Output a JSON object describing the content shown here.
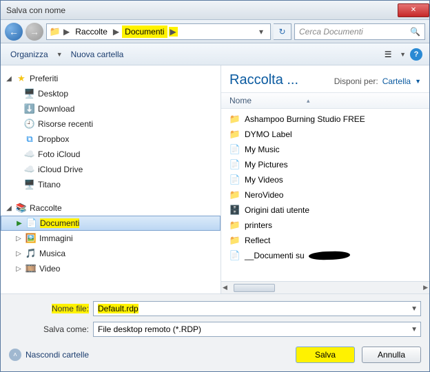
{
  "window": {
    "title": "Salva con nome"
  },
  "address": {
    "breadcrumbs": [
      "Raccolte",
      "Documenti"
    ],
    "search_placeholder": "Cerca Documenti"
  },
  "toolbar": {
    "organize": "Organizza",
    "new_folder": "Nuova cartella"
  },
  "tree": {
    "favorites_label": "Preferiti",
    "favorites": [
      {
        "label": "Desktop",
        "icon": "desktop"
      },
      {
        "label": "Download",
        "icon": "download"
      },
      {
        "label": "Risorse recenti",
        "icon": "recent"
      },
      {
        "label": "Dropbox",
        "icon": "dropbox"
      },
      {
        "label": "Foto iCloud",
        "icon": "icloud"
      },
      {
        "label": "iCloud Drive",
        "icon": "icloud"
      },
      {
        "label": "Titano",
        "icon": "computer"
      }
    ],
    "libraries_label": "Raccolte",
    "libraries": [
      {
        "label": "Documenti",
        "icon": "lib-doc",
        "selected": true
      },
      {
        "label": "Immagini",
        "icon": "lib-img"
      },
      {
        "label": "Musica",
        "icon": "lib-music"
      },
      {
        "label": "Video",
        "icon": "lib-video"
      }
    ]
  },
  "content": {
    "heading": "Raccolta ...",
    "arrange_label": "Disponi per:",
    "arrange_value": "Cartella",
    "column_name": "Nome",
    "items": [
      {
        "label": "Ashampoo Burning Studio FREE",
        "icon": "folder"
      },
      {
        "label": "DYMO Label",
        "icon": "folder"
      },
      {
        "label": "My Music",
        "icon": "lib"
      },
      {
        "label": "My Pictures",
        "icon": "lib"
      },
      {
        "label": "My Videos",
        "icon": "lib"
      },
      {
        "label": "NeroVideo",
        "icon": "folder"
      },
      {
        "label": "Origini dati utente",
        "icon": "dsn"
      },
      {
        "label": "printers",
        "icon": "folder"
      },
      {
        "label": "Reflect",
        "icon": "folder"
      },
      {
        "label": "__Documenti su",
        "icon": "lib",
        "redacted": true
      }
    ]
  },
  "fields": {
    "filename_label": "Nome file:",
    "filename_value": "Default.rdp",
    "saveas_label": "Salva come:",
    "saveas_value": "File desktop remoto (*.RDP)"
  },
  "buttons": {
    "hide_folders": "Nascondi cartelle",
    "save": "Salva",
    "cancel": "Annulla"
  }
}
